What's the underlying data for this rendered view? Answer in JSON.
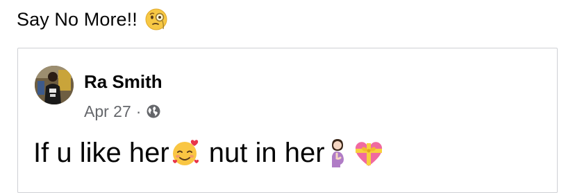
{
  "caption": {
    "text": "Say No More!!",
    "emoji": "face-with-monocle-icon"
  },
  "shared_post": {
    "author": "Ra Smith",
    "date": "Apr 27",
    "separator": "·",
    "audience": "globe-icon",
    "body": {
      "part1": "If u like her",
      "emoji1": "smiling-face-with-hearts-icon",
      "part2": " nut in her",
      "emoji2": "pregnant-woman-icon",
      "emoji3": "heart-with-ribbon-icon"
    }
  },
  "colors": {
    "text": "#050505",
    "meta": "#65676b",
    "border": "#ced0d4"
  }
}
